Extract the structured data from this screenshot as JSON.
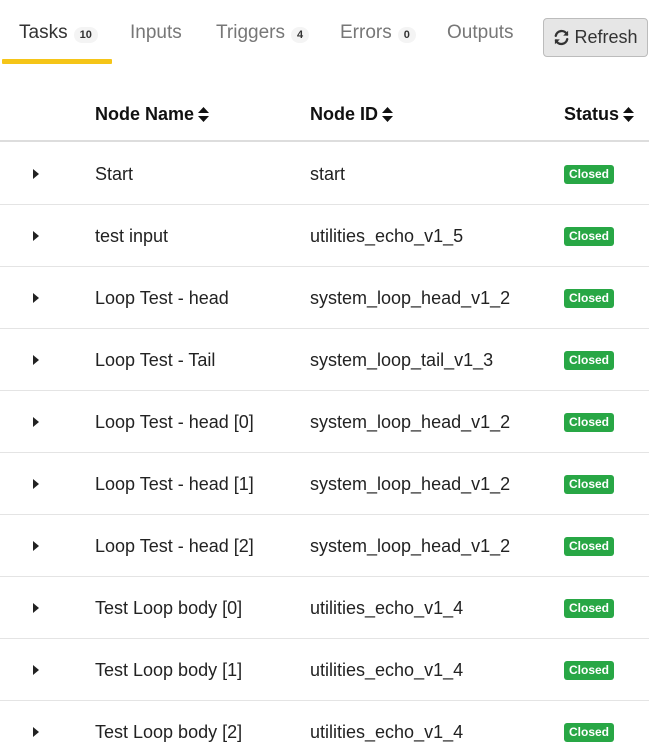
{
  "tabs": [
    {
      "label": "Tasks",
      "count": "10",
      "active": true
    },
    {
      "label": "Inputs",
      "count": null,
      "active": false
    },
    {
      "label": "Triggers",
      "count": "4",
      "active": false
    },
    {
      "label": "Errors",
      "count": "0",
      "active": false
    },
    {
      "label": "Outputs",
      "count": null,
      "active": false
    }
  ],
  "refresh": {
    "label": "Refresh",
    "icon": "refresh-icon"
  },
  "table": {
    "headers": {
      "name": "Node Name",
      "id": "Node ID",
      "status": "Status"
    },
    "rows": [
      {
        "name": "Start",
        "id": "start",
        "status": "Closed"
      },
      {
        "name": "test input",
        "id": "utilities_echo_v1_5",
        "status": "Closed"
      },
      {
        "name": "Loop Test - head",
        "id": "system_loop_head_v1_2",
        "status": "Closed"
      },
      {
        "name": "Loop Test - Tail",
        "id": "system_loop_tail_v1_3",
        "status": "Closed"
      },
      {
        "name": "Loop Test - head [0]",
        "id": "system_loop_head_v1_2",
        "status": "Closed"
      },
      {
        "name": "Loop Test - head [1]",
        "id": "system_loop_head_v1_2",
        "status": "Closed"
      },
      {
        "name": "Loop Test - head [2]",
        "id": "system_loop_head_v1_2",
        "status": "Closed"
      },
      {
        "name": "Test Loop body [0]",
        "id": "utilities_echo_v1_4",
        "status": "Closed"
      },
      {
        "name": "Test Loop body [1]",
        "id": "utilities_echo_v1_4",
        "status": "Closed"
      },
      {
        "name": "Test Loop body [2]",
        "id": "utilities_echo_v1_4",
        "status": "Closed"
      }
    ]
  },
  "colors": {
    "accent": "#f5c518",
    "status_closed": "#28a745"
  }
}
